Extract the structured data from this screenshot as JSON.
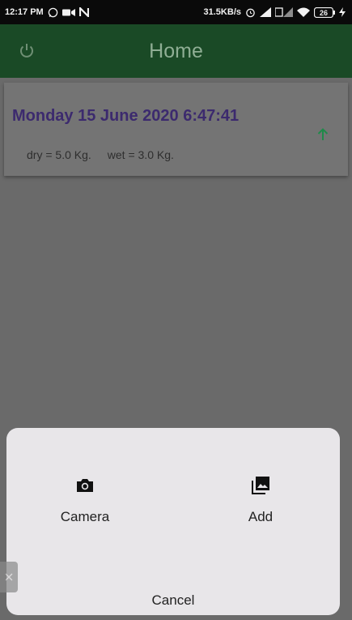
{
  "status_bar": {
    "time": "12:17 PM",
    "speed": "31.5KB/s",
    "battery": "26",
    "left_icons": [
      "whatsapp-icon",
      "video-icon",
      "n-icon"
    ],
    "right_icons": [
      "alarm-icon",
      "signal-icon",
      "wifi-icon",
      "battery-icon",
      "charging-icon"
    ]
  },
  "app_bar": {
    "title": "Home",
    "left_icon": "power-icon"
  },
  "entry": {
    "title": "Monday 15 June 2020 6:47:41",
    "dry": "dry = 5.0 Kg.",
    "wet": "wet = 3.0 Kg.",
    "icon": "arrow-up-icon"
  },
  "sheet": {
    "camera_label": "Camera",
    "add_label": "Add",
    "cancel_label": "Cancel"
  },
  "colors": {
    "app_bar": "#1a4a26",
    "title_text": "#8fae94",
    "entry_title": "#3c2a6e",
    "arrow": "#1f8a4a",
    "sheet_bg": "#e8e6e9"
  }
}
